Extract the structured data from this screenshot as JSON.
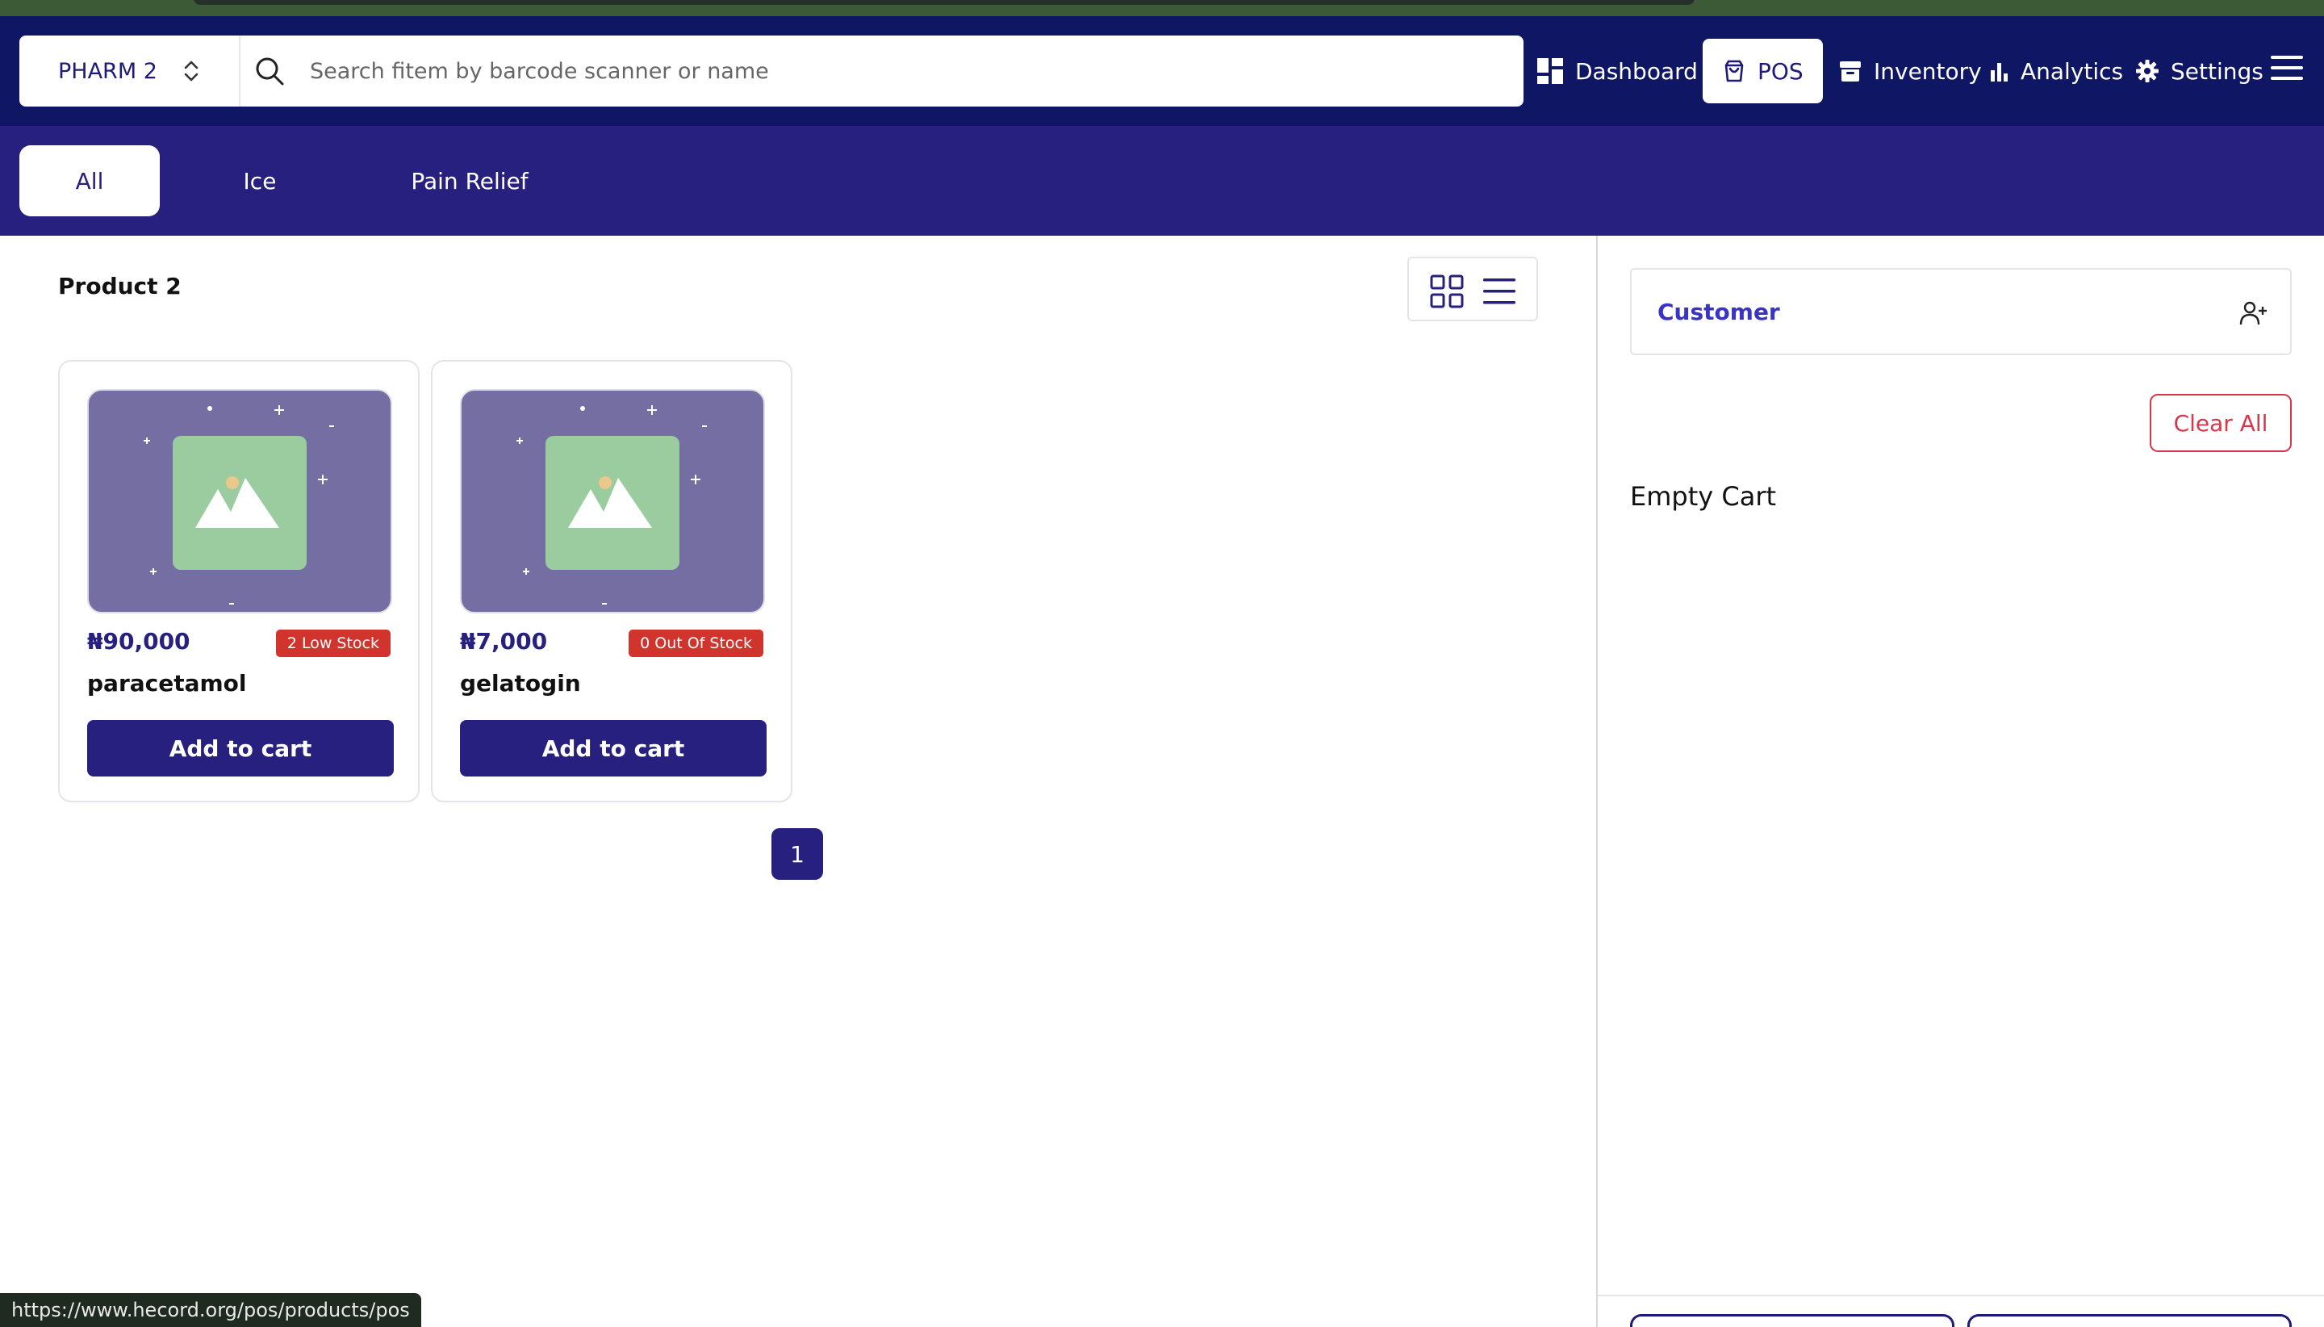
{
  "header": {
    "store": "PHARM 2",
    "search_placeholder": "Search fitem by barcode scanner or name",
    "nav": [
      {
        "label": "Dashboard",
        "icon": "dashboard-icon"
      },
      {
        "label": "POS",
        "icon": "shopping-bag-icon",
        "active": true
      },
      {
        "label": "Inventory",
        "icon": "archive-icon"
      },
      {
        "label": "Analytics",
        "icon": "bar-chart-icon"
      },
      {
        "label": "Settings",
        "icon": "gear-icon"
      }
    ]
  },
  "categories": [
    {
      "label": "All",
      "active": true
    },
    {
      "label": "Ice"
    },
    {
      "label": "Pain Relief"
    }
  ],
  "main": {
    "section_title": "Product 2",
    "products": [
      {
        "price": "₦90,000",
        "stock_badge": "2 Low Stock",
        "name": "paracetamol",
        "button": "Add to cart"
      },
      {
        "price": "₦7,000",
        "stock_badge": "0 Out Of Stock",
        "name": "gelatogin",
        "button": "Add to cart"
      }
    ],
    "page": "1"
  },
  "cart": {
    "customer_label": "Customer",
    "clear_label": "Clear All",
    "empty_text": "Empty Cart"
  },
  "status_bar": {
    "url": "https://www.hecord.org/pos/products/pos"
  },
  "colors": {
    "navbar": "#0f1764",
    "category_bar": "#27207e",
    "primary": "#27207e",
    "badge_red": "#d0342c",
    "clear_red": "#d8374b",
    "customer_link": "#3a33c4"
  }
}
